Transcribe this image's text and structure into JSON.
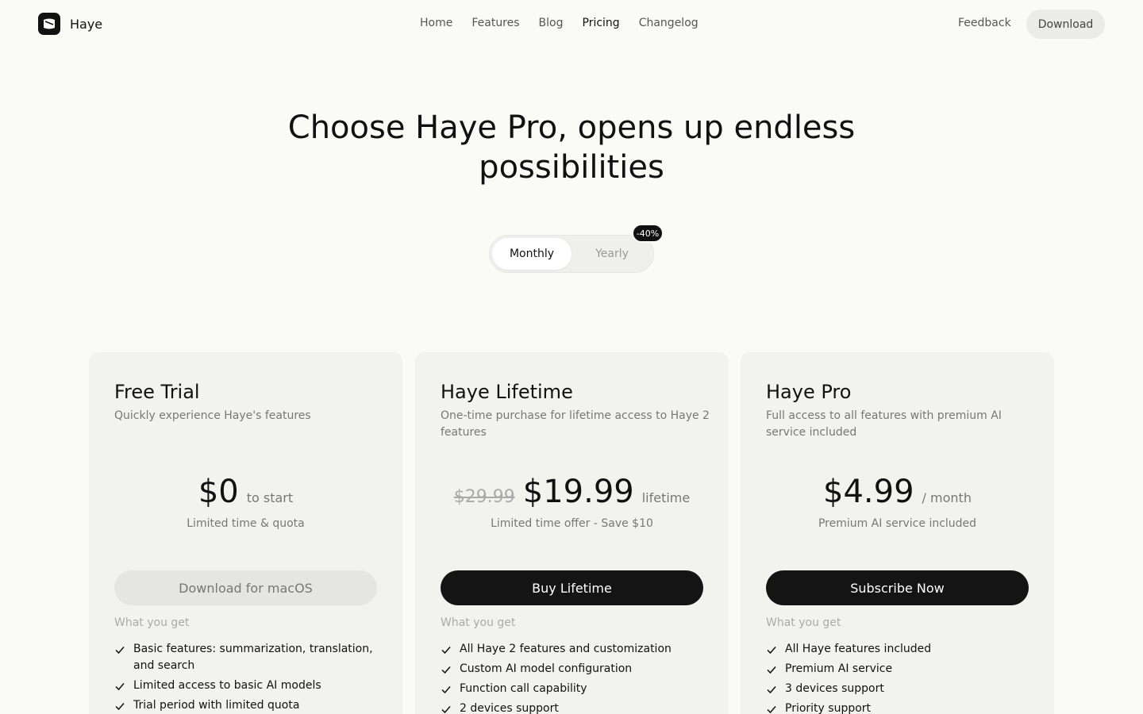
{
  "brand": {
    "name": "Haye"
  },
  "nav": {
    "items": [
      {
        "label": "Home",
        "active": false
      },
      {
        "label": "Features",
        "active": false
      },
      {
        "label": "Blog",
        "active": false
      },
      {
        "label": "Pricing",
        "active": true
      },
      {
        "label": "Changelog",
        "active": false
      }
    ],
    "feedback": "Feedback",
    "download": "Download"
  },
  "hero": {
    "title_line1": "Choose Haye Pro, opens up endless",
    "title_line2": "possibilities"
  },
  "billing_toggle": {
    "monthly": "Monthly",
    "yearly": "Yearly",
    "selected": "Monthly",
    "yearly_discount": "-40%"
  },
  "plans": [
    {
      "title": "Free Trial",
      "description": "Quickly experience Haye's features",
      "old_price": "",
      "price": "$0",
      "price_suffix": "to start",
      "price_note": "Limited time & quota",
      "cta": "Download for macOS",
      "cta_style": "light",
      "features_label": "What you get",
      "features": [
        "Basic features: summarization, translation, and search",
        "Limited access to basic AI models",
        "Trial period with limited quota"
      ]
    },
    {
      "title": "Haye Lifetime",
      "description": "One-time purchase for lifetime access to Haye 2 features",
      "old_price": "$29.99",
      "price": "$19.99",
      "price_suffix": "lifetime",
      "price_note": "Limited time offer - Save $10",
      "cta": "Buy Lifetime",
      "cta_style": "dark",
      "features_label": "What you get",
      "features": [
        "All Haye 2 features and customization",
        "Custom AI model configuration",
        "Function call capability",
        "2 devices support"
      ]
    },
    {
      "title": "Haye Pro",
      "description": "Full access to all features with premium AI service included",
      "old_price": "",
      "price": "$4.99",
      "price_suffix": "/ month",
      "price_note": "Premium AI service included",
      "cta": "Subscribe Now",
      "cta_style": "dark",
      "features_label": "What you get",
      "features": [
        "All Haye features included",
        "Premium AI service",
        "3 devices support",
        "Priority support"
      ]
    }
  ],
  "colors": {
    "accent": "#141414",
    "background": "#fafaf7",
    "card": "#f2f2ee"
  }
}
